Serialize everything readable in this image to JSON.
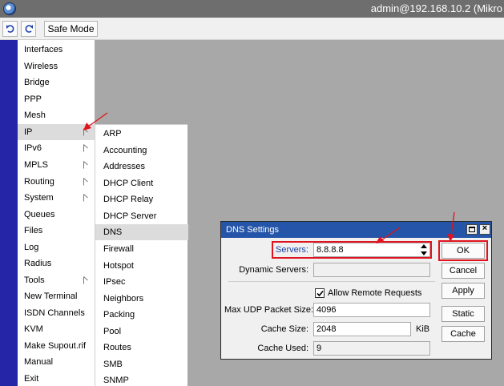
{
  "window": {
    "title": "admin@192.168.10.2 (Mikro"
  },
  "toolbar": {
    "safe_mode_label": "Safe Mode"
  },
  "main_menu": {
    "items": [
      {
        "label": "Interfaces"
      },
      {
        "label": "Wireless"
      },
      {
        "label": "Bridge"
      },
      {
        "label": "PPP"
      },
      {
        "label": "Mesh"
      },
      {
        "label": "IP"
      },
      {
        "label": "IPv6"
      },
      {
        "label": "MPLS"
      },
      {
        "label": "Routing"
      },
      {
        "label": "System"
      },
      {
        "label": "Queues"
      },
      {
        "label": "Files"
      },
      {
        "label": "Log"
      },
      {
        "label": "Radius"
      },
      {
        "label": "Tools"
      },
      {
        "label": "New Terminal"
      },
      {
        "label": "ISDN Channels"
      },
      {
        "label": "KVM"
      },
      {
        "label": "Make Supout.rif"
      },
      {
        "label": "Manual"
      },
      {
        "label": "Exit"
      }
    ]
  },
  "ip_submenu": {
    "items": [
      {
        "label": "ARP"
      },
      {
        "label": "Accounting"
      },
      {
        "label": "Addresses"
      },
      {
        "label": "DHCP Client"
      },
      {
        "label": "DHCP Relay"
      },
      {
        "label": "DHCP Server"
      },
      {
        "label": "DNS"
      },
      {
        "label": "Firewall"
      },
      {
        "label": "Hotspot"
      },
      {
        "label": "IPsec"
      },
      {
        "label": "Neighbors"
      },
      {
        "label": "Packing"
      },
      {
        "label": "Pool"
      },
      {
        "label": "Routes"
      },
      {
        "label": "SMB"
      },
      {
        "label": "SNMP"
      }
    ]
  },
  "dns_dialog": {
    "title": "DNS Settings",
    "servers_label": "Servers:",
    "servers_value": "8.8.8.8",
    "dynamic_servers_label": "Dynamic Servers:",
    "dynamic_servers_value": "",
    "allow_remote_label": "Allow Remote Requests",
    "allow_remote_checked": true,
    "max_udp_label": "Max UDP Packet Size:",
    "max_udp_value": "4096",
    "cache_size_label": "Cache Size:",
    "cache_size_value": "2048",
    "cache_size_unit": "KiB",
    "cache_used_label": "Cache Used:",
    "cache_used_value": "9",
    "buttons": {
      "ok": "OK",
      "cancel": "Cancel",
      "apply": "Apply",
      "static": "Static",
      "cache": "Cache"
    }
  },
  "colors": {
    "side_strip": "#2525a8",
    "dialog_title_bar": "#2455a8",
    "highlight": "#e0141e",
    "servers_label_color": "#1a3fa8"
  }
}
